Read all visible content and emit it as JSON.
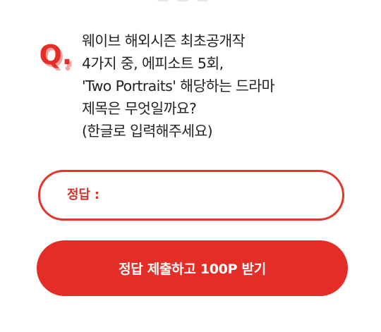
{
  "question": {
    "badge": "Q.",
    "lines": [
      "웨이브 해외시즌 최초공개작",
      "4가지 중, 에피소트 5회,",
      "'Two Portraits' 해당하는 드라마",
      "제목은 무엇일까요?",
      "(한글로 입력해주세요)"
    ]
  },
  "answer": {
    "label": "정답 :",
    "value": "",
    "placeholder": ""
  },
  "submit": {
    "label": "정답 제출하고 100P 받기"
  },
  "colors": {
    "accent": "#e32d26",
    "accent_border": "#e2352c",
    "text": "#222222",
    "background": "#ffffff"
  },
  "icons": {
    "question_badge": "q-letter-badge-icon"
  }
}
